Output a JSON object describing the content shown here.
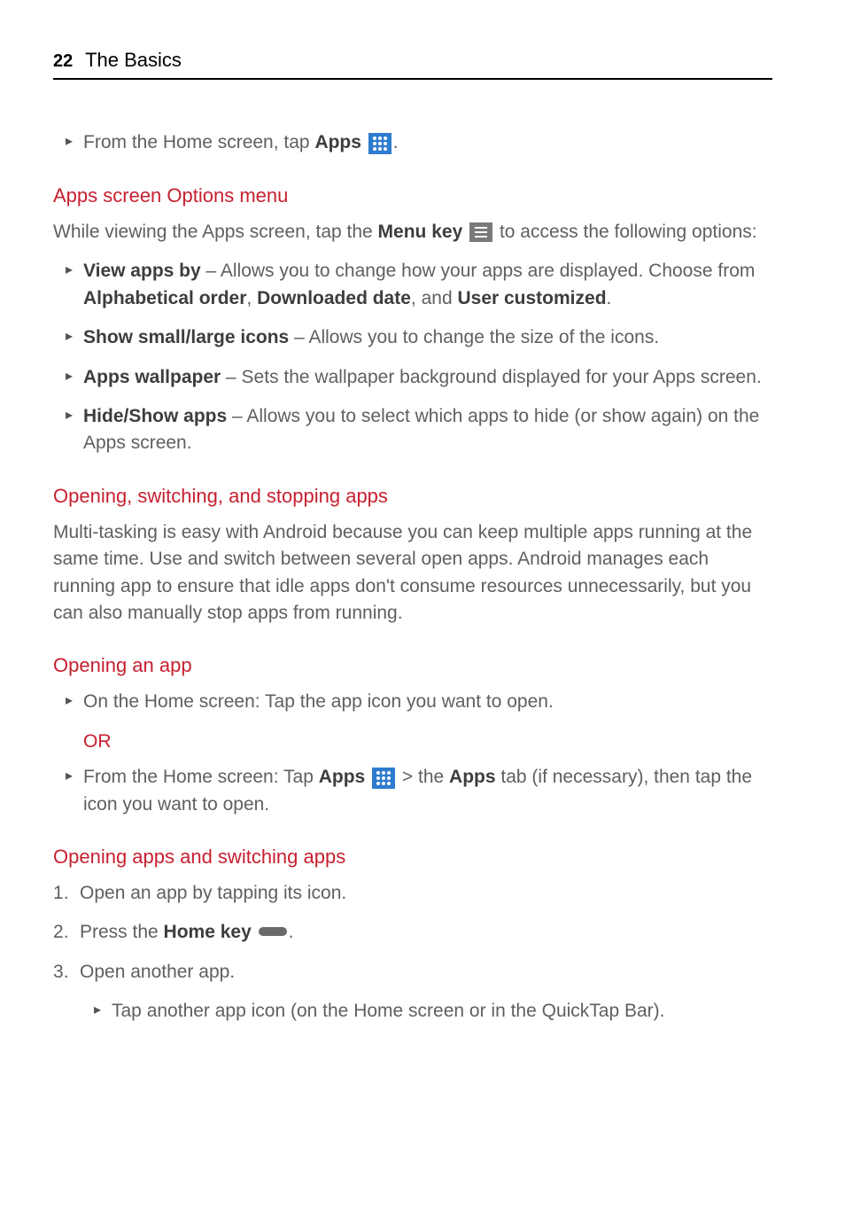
{
  "header": {
    "page_number": "22",
    "title": "The Basics"
  },
  "intro_bullet": {
    "prefix": "From the Home screen, tap ",
    "bold1": "Apps",
    "after_icon": "."
  },
  "h_apps_options": "Apps screen Options menu",
  "p_apps_options": {
    "t1": "While viewing the Apps screen, tap the ",
    "bold1": "Menu key",
    "t2": " to access the following options:"
  },
  "opt_items": [
    {
      "bold1": "View apps by",
      "t1": " – Allows you to change how your apps are displayed. Choose from ",
      "bold2": "Alphabetical order",
      "t2": ", ",
      "bold3": "Downloaded date",
      "t3": ", and ",
      "bold4": "User customized",
      "t4": "."
    },
    {
      "bold1": "Show small/large icons",
      "t1": " – Allows you to change the size of the icons."
    },
    {
      "bold1": "Apps wallpaper",
      "t1": " – Sets the wallpaper background displayed for your Apps screen."
    },
    {
      "bold1": "Hide/Show apps",
      "t1": " – Allows you to select which apps to hide (or show again) on the Apps screen."
    }
  ],
  "h_open_switch_stop": "Opening, switching, and stopping apps",
  "p_multi": "Multi-tasking is easy with Android because you can keep multiple apps running at the same time. Use and switch between several open apps. Android manages each running app to ensure that idle apps don't consume resources unnecessarily, but you can also manually stop apps from running.",
  "h_opening_app": "Opening an app",
  "open_b1": "On the Home screen: Tap the app icon you want to open.",
  "or_label": "OR",
  "open_b2": {
    "t1": "From the Home screen: Tap ",
    "bold1": "Apps",
    "t2": " > the  ",
    "bold2": "Apps",
    "t3": " tab (if necessary), then tap the icon you want to open."
  },
  "h_open_switch": "Opening apps and switching apps",
  "switch_steps": {
    "s1": "Open an app by tapping its icon.",
    "s2_t1": "Press the ",
    "s2_bold": "Home key",
    "s2_t2": ".",
    "s3": "Open another app."
  },
  "sub_bullet": "Tap another app icon (on the Home screen or in the QuickTap Bar)."
}
